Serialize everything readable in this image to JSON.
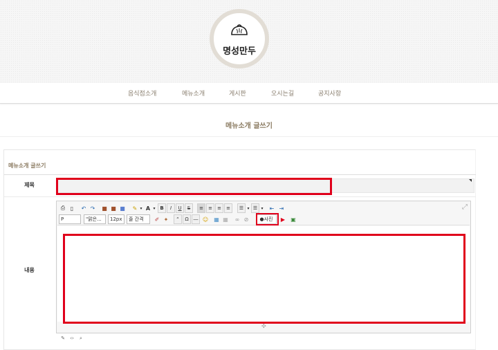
{
  "header": {
    "logo_text": "명성만두"
  },
  "nav": {
    "items": [
      "음식점소개",
      "메뉴소개",
      "게시판",
      "오시는길",
      "공지사항"
    ]
  },
  "page": {
    "title": "메뉴소개 글쓰기"
  },
  "form": {
    "panel_title": "메뉴소개 글쓰기",
    "title_label": "제목",
    "title_value": "",
    "content_label": "내용"
  },
  "editor": {
    "format_select": "P",
    "font_select": "\"맑은...",
    "size_select": "12px",
    "line_height_select": "줄 간격",
    "photo_button": "사진"
  },
  "colors": {
    "accent": "#8a7a60",
    "highlight": "#e0001b"
  }
}
